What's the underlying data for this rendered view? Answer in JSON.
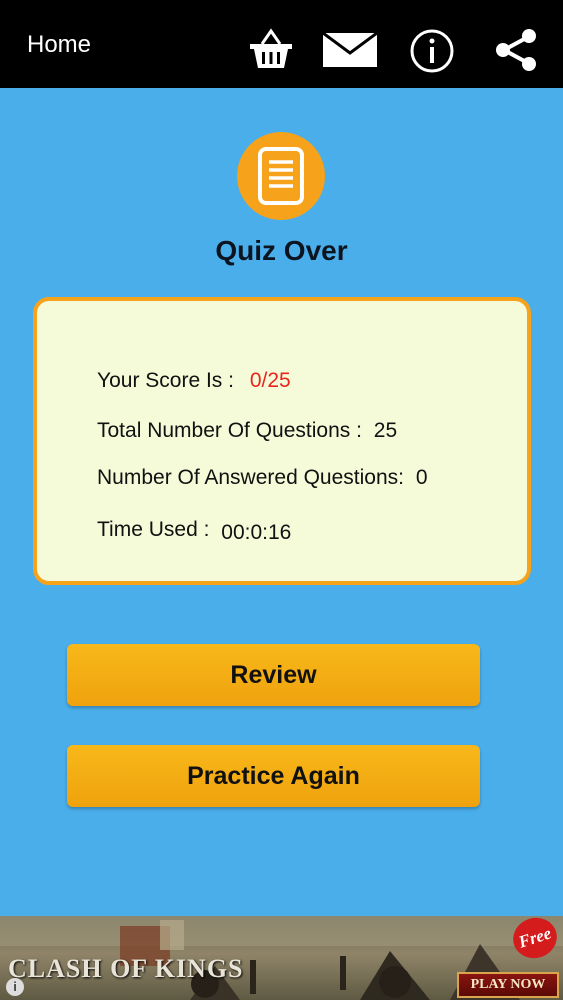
{
  "topbar": {
    "home_label": "Home",
    "icons": [
      "basket-icon",
      "mail-icon",
      "info-icon",
      "share-icon"
    ]
  },
  "quiz": {
    "icon": "document-icon",
    "title": "Quiz Over"
  },
  "result": {
    "score_label": "Your Score Is :",
    "score_value": "0/25",
    "total_label": "Total Number Of Questions :",
    "total_value": "25",
    "answered_label": "Number Of Answered Questions:",
    "answered_value": "0",
    "time_label": "Time Used :",
    "time_value": "00:0:16"
  },
  "buttons": {
    "review_label": "Review",
    "practice_label": "Practice Again"
  },
  "ad": {
    "logo_text": "CLASH OF KINGS",
    "badge_text": "Free",
    "cta_text": "PLAY NOW",
    "info_text": "i"
  },
  "colors": {
    "background": "#4aaeea",
    "topbar": "#000000",
    "accent": "#f6a21a",
    "card": "#f5fbd9",
    "score_red": "#e8261e"
  }
}
